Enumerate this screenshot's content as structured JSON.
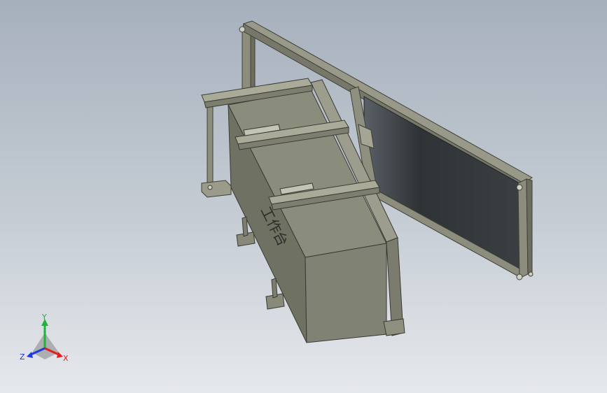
{
  "viewport": {
    "background_top": "#a6b0bc",
    "background_bottom": "#e6e9ec"
  },
  "model": {
    "box_markings": "工作台",
    "body_color": "#7b7d6e",
    "frame_color": "#909180",
    "panel_color": "#2e3336"
  },
  "triad": {
    "x_label": "X",
    "y_label": "Y",
    "z_label": "Z",
    "x_color": "#e01e1e",
    "y_color": "#1eb43c",
    "z_color": "#1e3cdc"
  }
}
